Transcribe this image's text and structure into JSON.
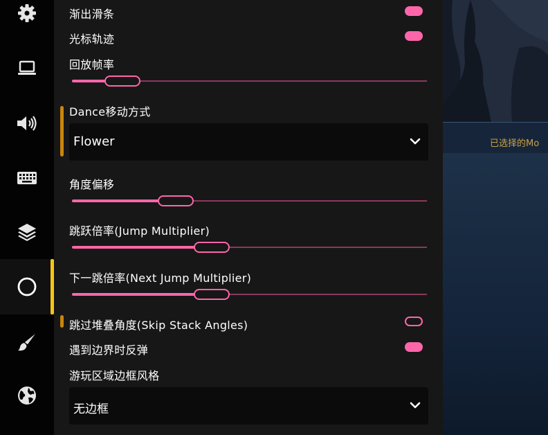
{
  "sidebar": {
    "items": [
      {
        "name": "gear-icon",
        "label": "settings"
      },
      {
        "name": "laptop-icon",
        "label": "display"
      },
      {
        "name": "speaker-icon",
        "label": "audio"
      },
      {
        "name": "keyboard-icon",
        "label": "input"
      },
      {
        "name": "layers-icon",
        "label": "skin"
      },
      {
        "name": "circle-icon",
        "label": "gameplay"
      },
      {
        "name": "brush-icon",
        "label": "editor"
      },
      {
        "name": "globe-icon",
        "label": "online"
      }
    ],
    "active_index": 5,
    "accent": "#f5c518"
  },
  "settings": {
    "fade_scrollbar": {
      "label": "渐出滑条",
      "on": true
    },
    "cursor_trail": {
      "label": "光标轨迹",
      "on": true
    },
    "replay_fps": {
      "label": "回放帧率",
      "level": 0.1
    },
    "dance_movement": {
      "label": "Dance移动方式",
      "value": "Flower"
    },
    "angle_offset": {
      "label": "角度偏移",
      "level": 0.25
    },
    "jump_multiplier": {
      "label": "跳跃倍率(Jump Multiplier)",
      "level": 0.35
    },
    "next_jump_multiplier": {
      "label": "下一跳倍率(Next Jump Multiplier)",
      "level": 0.35
    },
    "skip_stack_angles": {
      "label": "跳过堆叠角度(Skip Stack Angles)",
      "on": false
    },
    "bounce_on_edges": {
      "label": "遇到边界时反弹",
      "on": true
    },
    "playfield_border_style": {
      "label": "游玩区域边框风格",
      "value": "无边框"
    }
  },
  "background": {
    "selected_mods_text": "已选择的Mo"
  },
  "colors": {
    "accent_pink": "#ff66aa",
    "indicator": "#c7860a",
    "panel_bg": "#171717"
  }
}
